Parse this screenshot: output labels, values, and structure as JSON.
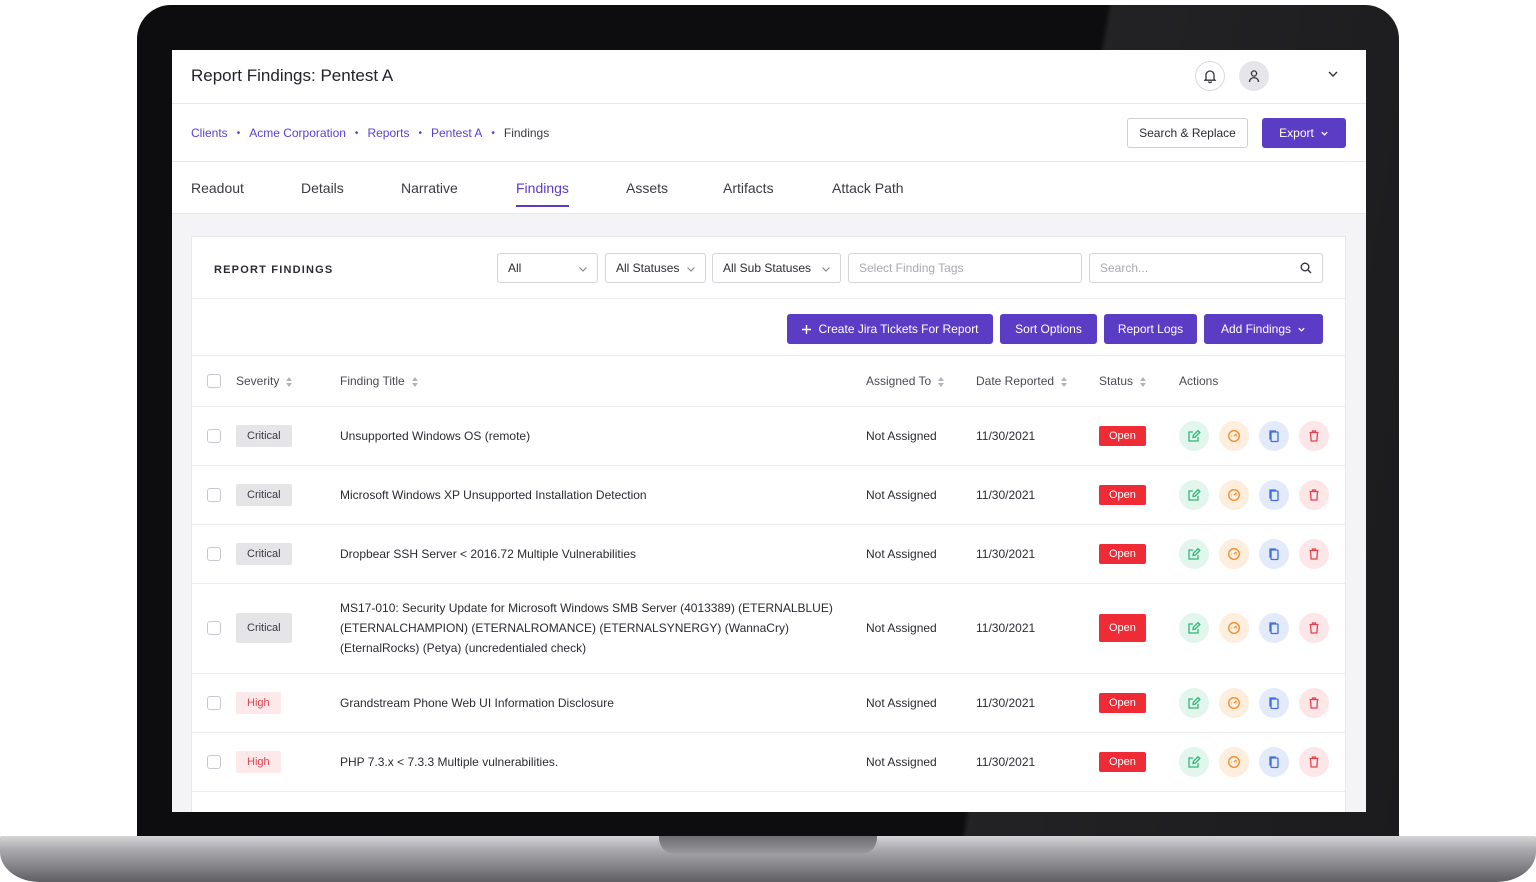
{
  "header": {
    "title": "Report Findings: Pentest A"
  },
  "breadcrumb": [
    "Clients",
    "Acme Corporation",
    "Reports",
    "Pentest A",
    "Findings"
  ],
  "header_actions": {
    "search_replace": "Search & Replace",
    "export": "Export"
  },
  "tabs": [
    "Readout",
    "Details",
    "Narrative",
    "Findings",
    "Assets",
    "Artifacts",
    "Attack Path"
  ],
  "active_tab": "Findings",
  "card": {
    "title": "REPORT FINDINGS",
    "filters": {
      "severity": "All",
      "status": "All Statuses",
      "sub_status": "All Sub Statuses",
      "tags_placeholder": "Select Finding Tags",
      "search_placeholder": "Search..."
    },
    "toolbar": {
      "create_jira": "Create Jira Tickets For Report",
      "sort_options": "Sort Options",
      "report_logs": "Report Logs",
      "add_findings": "Add Findings"
    }
  },
  "table": {
    "columns": [
      "Severity",
      "Finding Title",
      "Assigned To",
      "Date Reported",
      "Status",
      "Actions"
    ],
    "rows": [
      {
        "severity": "Critical",
        "title": "Unsupported Windows OS (remote)",
        "assigned": "Not Assigned",
        "date": "11/30/2021",
        "status": "Open"
      },
      {
        "severity": "Critical",
        "title": "Microsoft Windows XP Unsupported Installation Detection",
        "assigned": "Not Assigned",
        "date": "11/30/2021",
        "status": "Open"
      },
      {
        "severity": "Critical",
        "title": "Dropbear SSH Server < 2016.72 Multiple Vulnerabilities",
        "assigned": "Not Assigned",
        "date": "11/30/2021",
        "status": "Open"
      },
      {
        "severity": "Critical",
        "title": "MS17-010: Security Update for Microsoft Windows SMB Server (4013389) (ETERNALBLUE) (ETERNALCHAMPION) (ETERNALROMANCE) (ETERNALSYNERGY) (WannaCry) (EternalRocks) (Petya) (uncredentialed check)",
        "assigned": "Not Assigned",
        "date": "11/30/2021",
        "status": "Open"
      },
      {
        "severity": "High",
        "title": "Grandstream Phone Web UI Information Disclosure",
        "assigned": "Not Assigned",
        "date": "11/30/2021",
        "status": "Open"
      },
      {
        "severity": "High",
        "title": "PHP 7.3.x < 7.3.3 Multiple vulnerabilities.",
        "assigned": "Not Assigned",
        "date": "11/30/2021",
        "status": "Open"
      }
    ]
  },
  "icons": [
    "bell-icon",
    "user-icon",
    "chevron-down-icon",
    "search-icon",
    "plus-icon",
    "sort-icon",
    "edit-icon",
    "retest-icon",
    "copy-icon",
    "trash-icon"
  ],
  "colors": {
    "accent": "#5b3cc4",
    "status_open": "#ef2b35",
    "severity_high_text": "#e2434f",
    "edit": "#2fb57a",
    "retest": "#f08a2a",
    "copy": "#3f6fd6",
    "delete": "#e2434f"
  }
}
